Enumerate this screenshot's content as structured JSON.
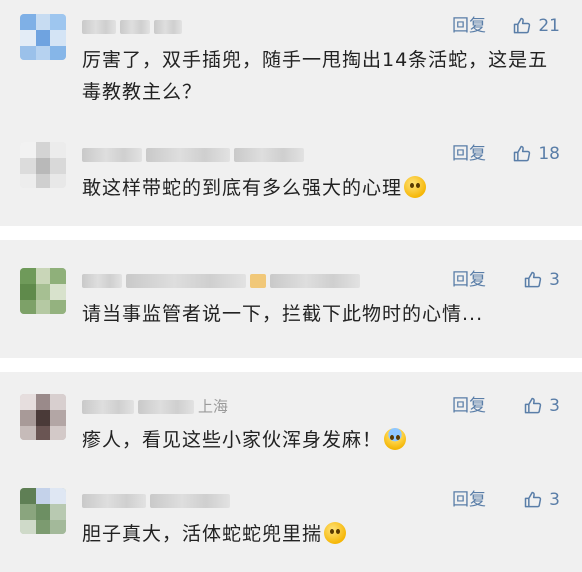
{
  "comments": [
    {
      "name_visible": "",
      "reply_label": "回复",
      "like_count": "21",
      "text": "厉害了，双手插兜，随手一甩掏出14条活蛇，这是五毒教教主么？",
      "emoji": ""
    },
    {
      "name_visible": "",
      "reply_label": "回复",
      "like_count": "18",
      "text": "敢这样带蛇的到底有多么强大的心理",
      "emoji": "flushed-face-emoji"
    },
    {
      "name_visible": "",
      "reply_label": "回复",
      "like_count": "3",
      "text": "请当事监管者说一下，拦截下此物时的心情...",
      "emoji": ""
    },
    {
      "name_visible": "上海",
      "reply_label": "回复",
      "like_count": "3",
      "text": "瘆人，看见这些小家伙浑身发麻！",
      "emoji": "fearful-face-emoji"
    },
    {
      "name_visible": "",
      "reply_label": "回复",
      "like_count": "3",
      "text": "胆子真大，活体蛇蛇兜里揣",
      "emoji": "pleading-face-emoji"
    }
  ],
  "colors": {
    "card_bg": "#f0f0f0",
    "link_blue": "#5a7ea8",
    "text": "#222222",
    "meta_gray": "#9a9a9a"
  }
}
